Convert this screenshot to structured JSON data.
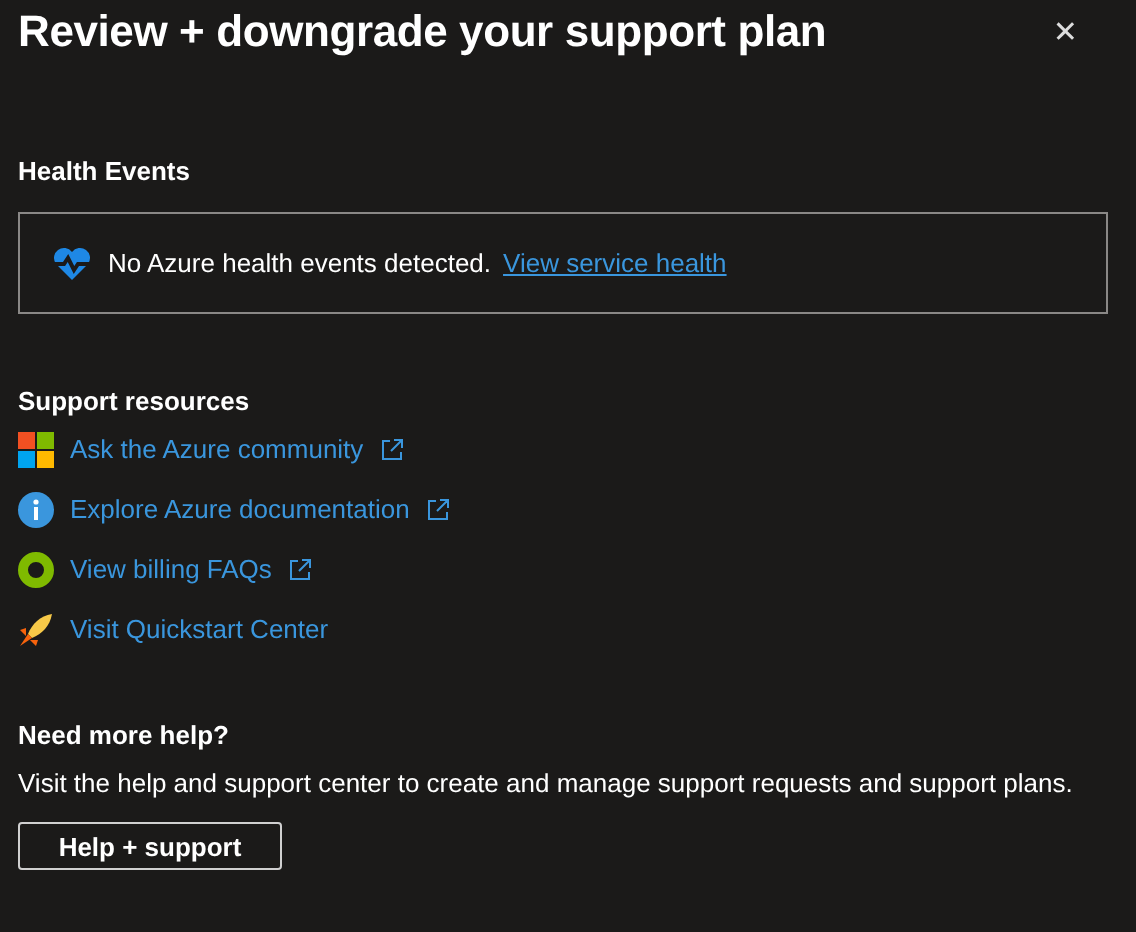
{
  "panel": {
    "title": "Review + downgrade your support plan",
    "close": "✕"
  },
  "health": {
    "heading": "Health Events",
    "message": "No Azure health events detected.",
    "link": "View service health"
  },
  "resources": {
    "heading": "Support resources",
    "items": [
      {
        "kind": "tiles",
        "label": "Ask the Azure community",
        "external": true
      },
      {
        "kind": "info",
        "label": "Explore Azure documentation",
        "external": true
      },
      {
        "kind": "ring",
        "label": "View billing FAQs",
        "external": true
      },
      {
        "kind": "rocket",
        "label": "Visit Quickstart Center",
        "external": false
      }
    ]
  },
  "help": {
    "heading": "Need more help?",
    "text": "Visit the help and support center to create and manage support requests and support plans.",
    "button": "Help + support"
  }
}
